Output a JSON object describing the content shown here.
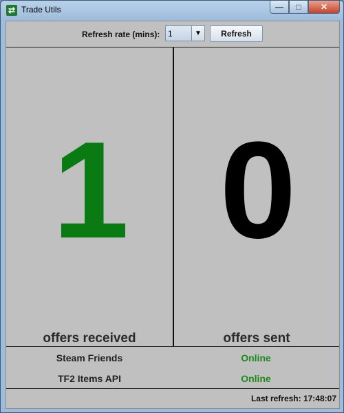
{
  "window": {
    "title": "Trade Utils",
    "buttons": {
      "minimize": "—",
      "maximize": "□",
      "close": "✕"
    }
  },
  "toolbar": {
    "refresh_rate_label": "Refresh rate (mins):",
    "refresh_rate_value": "1",
    "refresh_button_label": "Refresh"
  },
  "counters": {
    "received": {
      "value": "1",
      "label": "offers received",
      "color": "#0a7a12"
    },
    "sent": {
      "value": "0",
      "label": "offers sent",
      "color": "#000000"
    }
  },
  "status": {
    "items": [
      {
        "name": "Steam Friends",
        "state": "Online",
        "state_color": "#1b8a1b"
      },
      {
        "name": "TF2 Items API",
        "state": "Online",
        "state_color": "#1b8a1b"
      }
    ]
  },
  "footer": {
    "last_refresh": "Last refresh: 17:48:07"
  },
  "icons": {
    "app": "trade-arrows-icon",
    "dropdown": "chevron-down-icon"
  }
}
